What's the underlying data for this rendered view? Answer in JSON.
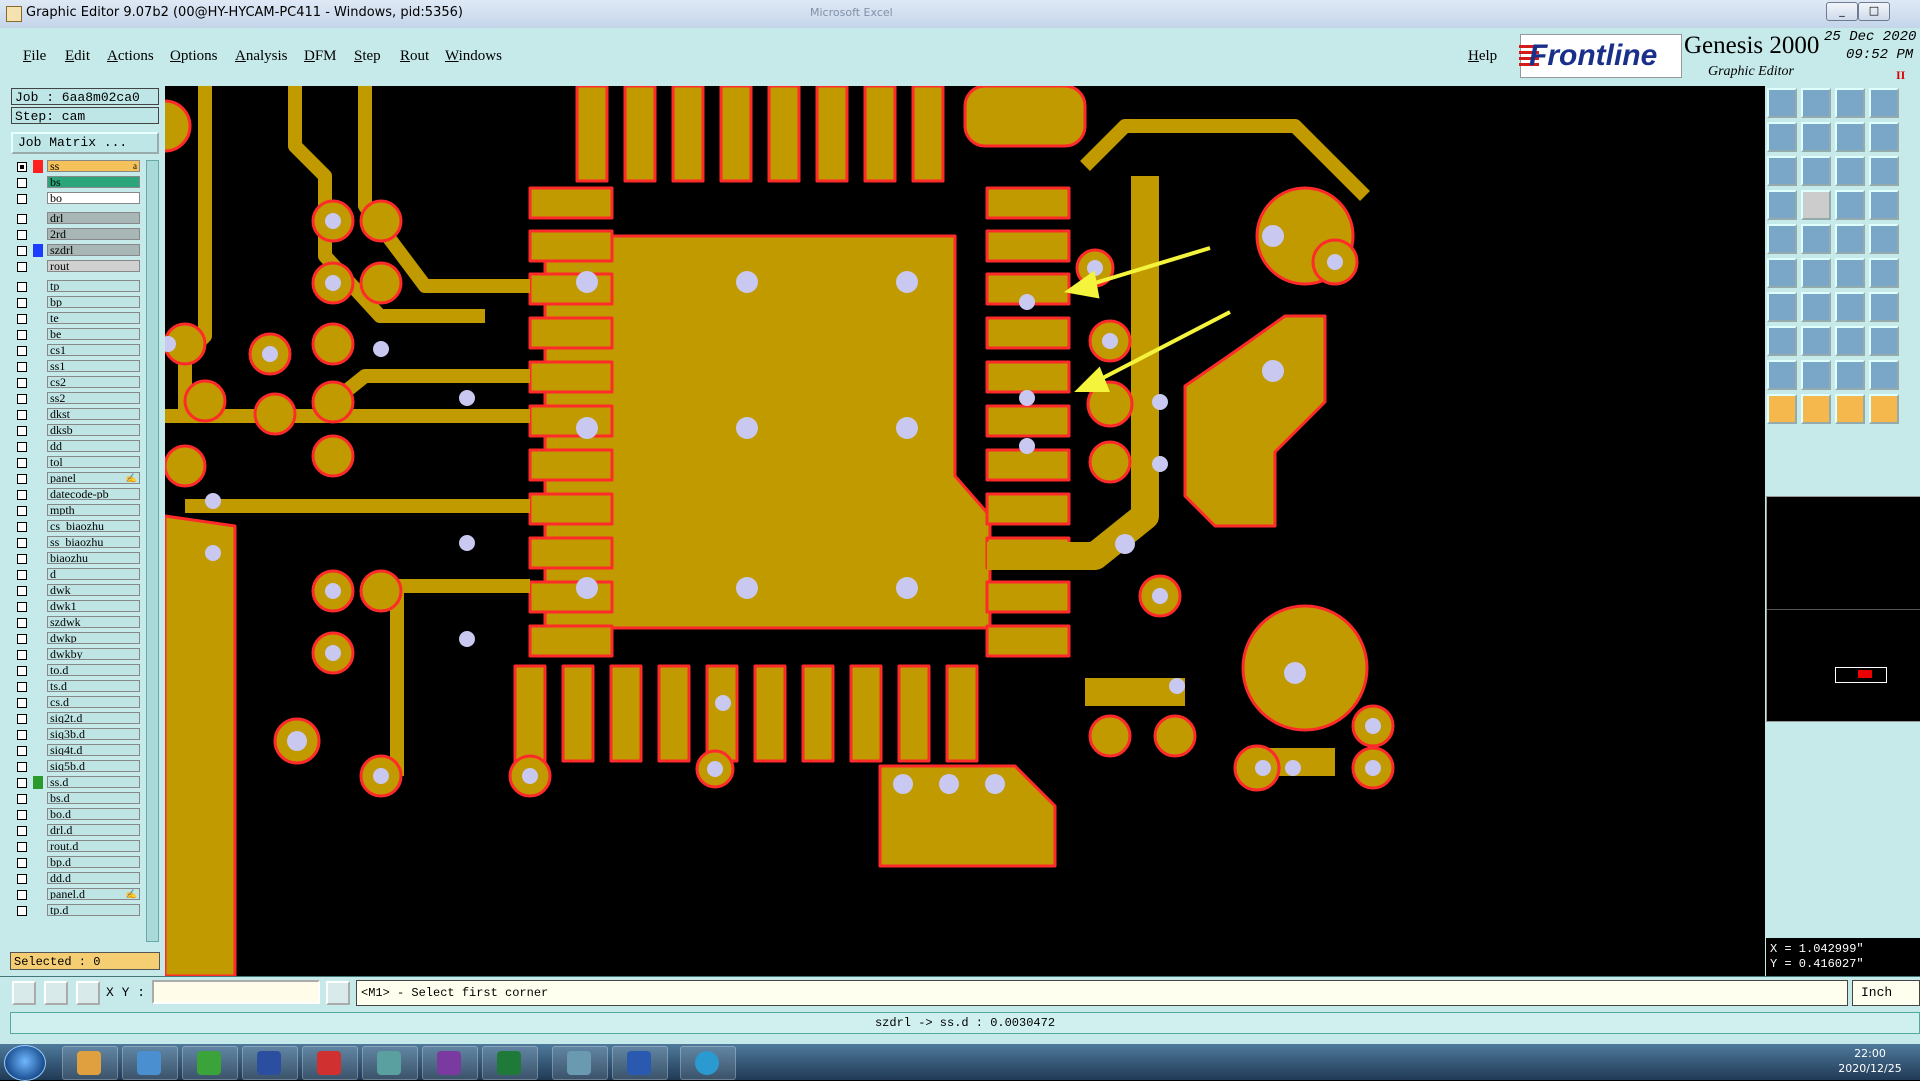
{
  "window": {
    "title": "Graphic Editor 9.07b2 (00@HY-HYCAM-PC411 - Windows, pid:5356)",
    "background_window_title": "Microsoft Excel",
    "controls": [
      "_",
      "□",
      "✕"
    ]
  },
  "menu": {
    "items": [
      "File",
      "Edit",
      "Actions",
      "Options",
      "Analysis",
      "DFM",
      "Step",
      "Rout",
      "Windows"
    ],
    "help": "Help"
  },
  "brand": {
    "logo": "Frontline",
    "product": "Genesis 2000",
    "subtitle": "Graphic Editor",
    "date": "25 Dec 2020",
    "time": "09:52 PM",
    "indicator": "II"
  },
  "job": {
    "job_label": "Job : 6aa8m02ca0",
    "step_label": "Step: cam",
    "matrix_button": "Job Matrix ..."
  },
  "layers": [
    {
      "name": "ss",
      "swatch": "#ff2020",
      "bg": "#f5c15a",
      "flag": "a",
      "checked": true
    },
    {
      "name": "bs",
      "swatch": "",
      "bg": "#2aa67a"
    },
    {
      "name": "bo",
      "swatch": "",
      "bg": "#ffffff"
    },
    {
      "name": "drl",
      "swatch": "",
      "bg": "#a9b6b6",
      "gap": true
    },
    {
      "name": "2rd",
      "swatch": "",
      "bg": "#a9b6b6"
    },
    {
      "name": "szdrl",
      "swatch": "#1e3cff",
      "bg": "#a9b6b6"
    },
    {
      "name": "rout",
      "swatch": "",
      "bg": "#d0d0d0"
    },
    {
      "name": "tp",
      "swatch": "",
      "bg": "#bfe4e4",
      "gap": true
    },
    {
      "name": "bp",
      "swatch": "",
      "bg": "#bfe4e4"
    },
    {
      "name": "te",
      "swatch": "",
      "bg": "#bfe4e4"
    },
    {
      "name": "be",
      "swatch": "",
      "bg": "#bfe4e4"
    },
    {
      "name": "cs1",
      "swatch": "",
      "bg": "#bfe4e4"
    },
    {
      "name": "ss1",
      "swatch": "",
      "bg": "#bfe4e4"
    },
    {
      "name": "cs2",
      "swatch": "",
      "bg": "#bfe4e4"
    },
    {
      "name": "ss2",
      "swatch": "",
      "bg": "#bfe4e4"
    },
    {
      "name": "dkst",
      "swatch": "",
      "bg": "#bfe4e4"
    },
    {
      "name": "dksb",
      "swatch": "",
      "bg": "#bfe4e4"
    },
    {
      "name": "dd",
      "swatch": "",
      "bg": "#bfe4e4"
    },
    {
      "name": "tol",
      "swatch": "",
      "bg": "#bfe4e4"
    },
    {
      "name": "panel",
      "swatch": "",
      "bg": "#bfe4e4",
      "flag": "✍"
    },
    {
      "name": "datecode-pb",
      "swatch": "",
      "bg": "#bfe4e4"
    },
    {
      "name": "mpth",
      "swatch": "",
      "bg": "#bfe4e4"
    },
    {
      "name": "cs_biaozhu",
      "swatch": "",
      "bg": "#bfe4e4"
    },
    {
      "name": "ss_biaozhu",
      "swatch": "",
      "bg": "#bfe4e4"
    },
    {
      "name": "biaozhu",
      "swatch": "",
      "bg": "#bfe4e4"
    },
    {
      "name": "d",
      "swatch": "",
      "bg": "#bfe4e4"
    },
    {
      "name": "dwk",
      "swatch": "",
      "bg": "#bfe4e4"
    },
    {
      "name": "dwk1",
      "swatch": "",
      "bg": "#bfe4e4"
    },
    {
      "name": "szdwk",
      "swatch": "",
      "bg": "#bfe4e4"
    },
    {
      "name": "dwkp",
      "swatch": "",
      "bg": "#bfe4e4"
    },
    {
      "name": "dwkby",
      "swatch": "",
      "bg": "#bfe4e4"
    },
    {
      "name": "to.d",
      "swatch": "",
      "bg": "#bfe4e4"
    },
    {
      "name": "ts.d",
      "swatch": "",
      "bg": "#bfe4e4"
    },
    {
      "name": "cs.d",
      "swatch": "",
      "bg": "#bfe4e4"
    },
    {
      "name": "siq2t.d",
      "swatch": "",
      "bg": "#bfe4e4"
    },
    {
      "name": "siq3b.d",
      "swatch": "",
      "bg": "#bfe4e4"
    },
    {
      "name": "siq4t.d",
      "swatch": "",
      "bg": "#bfe4e4"
    },
    {
      "name": "siq5b.d",
      "swatch": "",
      "bg": "#bfe4e4"
    },
    {
      "name": "ss.d",
      "swatch": "#2a9a2a",
      "bg": "#bfe4e4"
    },
    {
      "name": "bs.d",
      "swatch": "",
      "bg": "#bfe4e4"
    },
    {
      "name": "bo.d",
      "swatch": "",
      "bg": "#bfe4e4"
    },
    {
      "name": "drl.d",
      "swatch": "",
      "bg": "#bfe4e4"
    },
    {
      "name": "rout.d",
      "swatch": "",
      "bg": "#bfe4e4"
    },
    {
      "name": "bp.d",
      "swatch": "",
      "bg": "#bfe4e4"
    },
    {
      "name": "dd.d",
      "swatch": "",
      "bg": "#bfe4e4"
    },
    {
      "name": "panel.d",
      "swatch": "",
      "bg": "#bfe4e4",
      "flag": "✍"
    },
    {
      "name": "tp.d",
      "swatch": "",
      "bg": "#bfe4e4"
    }
  ],
  "selected": "Selected : 0",
  "coords": {
    "x": "X = 1.042999\"",
    "y": "Y = 0.416027\""
  },
  "command": {
    "xy_label": "X Y :",
    "xy_value": "",
    "prompt": "<M1> - Select first corner",
    "units": "Inch"
  },
  "message": "szdrl -> ss.d : 0.0030472",
  "taskbar": {
    "time": "22:00",
    "date": "2020/12/25"
  },
  "colors": {
    "copper": "#c19a00",
    "outline": "#ff2a2a",
    "drill": "#c8c8f0",
    "arrow": "#f4f43c",
    "panel": "#c6eaea"
  }
}
